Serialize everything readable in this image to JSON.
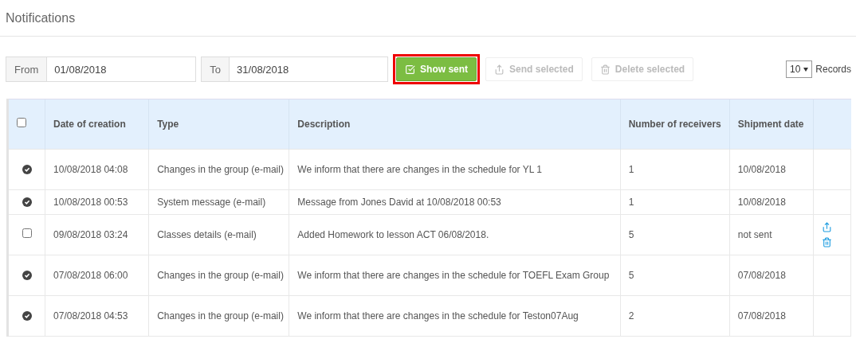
{
  "page": {
    "title": "Notifications"
  },
  "filters": {
    "from_label": "From",
    "from_value": "01/08/2018",
    "to_label": "To",
    "to_value": "31/08/2018"
  },
  "buttons": [
    {
      "kind": "toggle",
      "label": "Show sent",
      "highlighted": true,
      "disabled": false
    },
    {
      "kind": "send",
      "label": "Send selected",
      "highlighted": false,
      "disabled": true
    },
    {
      "kind": "delete",
      "label": "Delete selected",
      "highlighted": false,
      "disabled": true
    }
  ],
  "page_size": {
    "value": "10",
    "label": "Records"
  },
  "table": {
    "select_all_checked": false,
    "columns": [
      "Date of creation",
      "Type",
      "Description",
      "Number of receivers",
      "Shipment date"
    ],
    "rows": [
      {
        "sent": true,
        "created": "10/08/2018 04:08",
        "type": "Changes in the group (e-mail)",
        "description": "We inform that there are changes in the schedule for YL 1",
        "receivers": "1",
        "shipment": "10/08/2018"
      },
      {
        "sent": true,
        "created": "10/08/2018 00:53",
        "type": "System message (e-mail)",
        "description": "Message from Jones David at 10/08/2018 00:53",
        "receivers": "1",
        "shipment": "10/08/2018"
      },
      {
        "sent": false,
        "checked": false,
        "created": "09/08/2018 03:24",
        "type": "Classes details (e-mail)",
        "description": "Added Homework to lesson ACT 06/08/2018.",
        "receivers": "5",
        "shipment": "not sent"
      },
      {
        "sent": true,
        "created": "07/08/2018 06:00",
        "type": "Changes in the group (e-mail)",
        "description": "We inform that there are changes in the schedule for TOEFL Exam Group",
        "receivers": "5",
        "shipment": "07/08/2018"
      },
      {
        "sent": true,
        "created": "07/08/2018 04:53",
        "type": "Changes in the group (e-mail)",
        "description": "We inform that there are changes in the schedule for Teston07Aug",
        "receivers": "2",
        "shipment": "07/08/2018"
      }
    ]
  }
}
